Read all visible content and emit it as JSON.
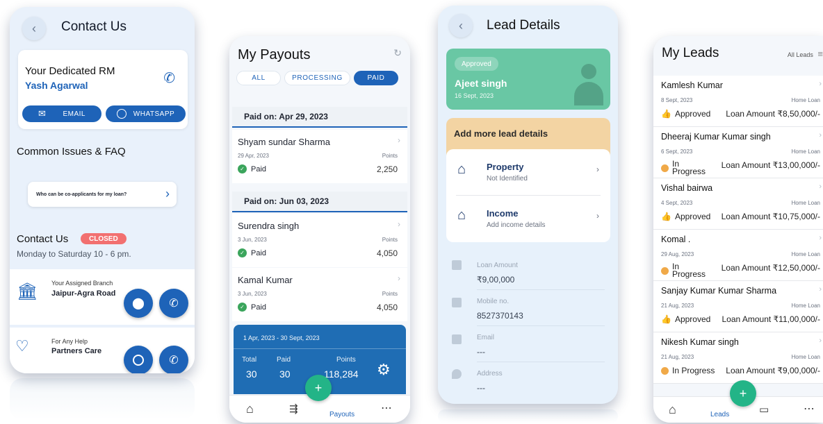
{
  "contact": {
    "title": "Contact Us",
    "rm_label": "Your Dedicated RM",
    "rm_name": "Yash Agarwal",
    "email_label": "EMAIL",
    "whatsapp_label": "WHATSAPP",
    "faq_heading": "Common Issues & FAQ",
    "faq_question": "Who can be co-applicants for my loan?",
    "contact_heading": "Contact Us",
    "status_badge": "CLOSED",
    "hours": "Monday to Saturday 10 - 6 pm.",
    "branch_label": "Your Assigned Branch",
    "branch_name": "Jaipur-Agra Road",
    "help_label": "For Any Help",
    "help_name": "Partners Care"
  },
  "payouts": {
    "title": "My Payouts",
    "tabs": [
      "ALL",
      "PROCESSING",
      "PAID"
    ],
    "active_tab": "PAID",
    "sections": [
      {
        "header": "Paid on: Apr 29, 2023",
        "items": [
          {
            "name": "Shyam sundar Sharma",
            "date": "29 Apr, 2023",
            "points_label": "Points",
            "status": "Paid",
            "points": "2,250"
          }
        ]
      },
      {
        "header": "Paid on: Jun 03, 2023",
        "items": [
          {
            "name": "Surendra singh",
            "date": "3 Jun, 2023",
            "points_label": "Points",
            "status": "Paid",
            "points": "4,050"
          },
          {
            "name": "Kamal Kumar",
            "date": "3 Jun, 2023",
            "points_label": "Points",
            "status": "Paid",
            "points": "4,050"
          }
        ]
      }
    ],
    "summary": {
      "range": "1 Apr, 2023 - 30 Sept, 2023",
      "total_label": "Total",
      "total": "30",
      "paid_label": "Paid",
      "paid": "30",
      "points_label": "Points",
      "points": "118,284"
    },
    "nav_active": "Payouts"
  },
  "lead_details": {
    "title": "Lead Details",
    "status": "Approved",
    "name": "Ajeet singh",
    "date": "16 Sept, 2023",
    "add_more": "Add more lead details",
    "property_title": "Property",
    "property_sub": "Not Identified",
    "income_title": "Income",
    "income_sub": "Add income details",
    "fields": [
      {
        "label": "Loan Amount",
        "value": "₹9,00,000"
      },
      {
        "label": "Mobile no.",
        "value": "8527370143"
      },
      {
        "label": "Email",
        "value": "---"
      },
      {
        "label": "Address",
        "value": "---"
      }
    ]
  },
  "leads": {
    "title": "My Leads",
    "filter": "All Leads",
    "items": [
      {
        "name": "Kamlesh Kumar",
        "date": "8 Sept, 2023",
        "type": "Home Loan",
        "status": "Approved",
        "amount": "Loan Amount ₹8,50,000/-"
      },
      {
        "name": "Dheeraj Kumar Kumar singh",
        "date": "6 Sept, 2023",
        "type": "Home Loan",
        "status": "In Progress",
        "amount": "Loan Amount ₹13,00,000/-"
      },
      {
        "name": "Vishal bairwa",
        "date": "4 Sept, 2023",
        "type": "Home Loan",
        "status": "Approved",
        "amount": "Loan Amount ₹10,75,000/-"
      },
      {
        "name": "Komal .",
        "date": "29 Aug, 2023",
        "type": "Home Loan",
        "status": "In Progress",
        "amount": "Loan Amount ₹12,50,000/-"
      },
      {
        "name": "Sanjay Kumar Kumar Sharma",
        "date": "21 Aug, 2023",
        "type": "Home Loan",
        "status": "Approved",
        "amount": "Loan Amount ₹11,00,000/-"
      },
      {
        "name": "Nikesh Kumar singh",
        "date": "21 Aug, 2023",
        "type": "Home Loan",
        "status": "In Progress",
        "amount": "Loan Amount ₹9,00,000/-"
      }
    ],
    "nav_active": "Leads"
  },
  "colors": {
    "primary": "#1e63b8",
    "success": "#3ba55c",
    "accent": "#23b487",
    "closed": "#f27070",
    "progress": "#f0a948"
  }
}
